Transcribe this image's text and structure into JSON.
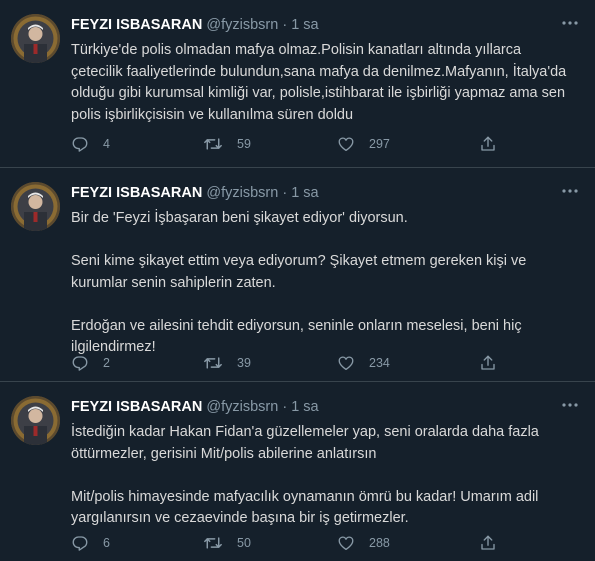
{
  "tweets": [
    {
      "author_name": "FEYZI ISBASARAN",
      "handle": "@fyzisbsrn",
      "separator": "·",
      "time": "1 sa",
      "paragraphs": [
        "Türkiye'de polis olmadan mafya olmaz.Polisin kanatları altında yıllarca çetecilik faaliyetlerinde bulundun,sana mafya da denilmez.Mafyanın, İtalya'da olduğu gibi kurumsal kimliği var, polisle,istihbarat ile işbirliği yapmaz ama sen polis işbirlikçisisin ve kullanılma süren doldu"
      ],
      "replies": "4",
      "retweets": "59",
      "likes": "297"
    },
    {
      "author_name": "FEYZI ISBASARAN",
      "handle": "@fyzisbsrn",
      "separator": "·",
      "time": "1 sa",
      "paragraphs": [
        "Bir de 'Feyzi İşbaşaran beni şikayet ediyor' diyorsun.",
        "Seni kime şikayet ettim veya ediyorum? Şikayet etmem gereken kişi ve kurumlar senin sahiplerin zaten.",
        "Erdoğan ve ailesini tehdit ediyorsun, seninle onların meselesi, beni hiç ilgilendirmez!"
      ],
      "replies": "2",
      "retweets": "39",
      "likes": "234"
    },
    {
      "author_name": "FEYZI ISBASARAN",
      "handle": "@fyzisbsrn",
      "separator": "·",
      "time": "1 sa",
      "paragraphs": [
        "İstediğin kadar Hakan Fidan'a güzellemeler yap, seni oralarda daha fazla öttürmezler, gerisini Mit/polis abilerine anlatırsın",
        "Mit/polis himayesinde mafyacılık oynamanın ömrü bu kadar! Umarım adil yargılanırsın ve cezaevinde başına bir iş getirmezler."
      ],
      "replies": "6",
      "retweets": "50",
      "likes": "288"
    }
  ],
  "icons": {
    "reply": "reply-icon",
    "retweet": "retweet-icon",
    "like": "heart-icon",
    "share": "share-icon",
    "more": "more-options-icon"
  },
  "colors": {
    "background": "#15202b",
    "text": "#d9d9d9",
    "name": "#ffffff",
    "muted": "#8899a6",
    "divider": "#38444d"
  }
}
